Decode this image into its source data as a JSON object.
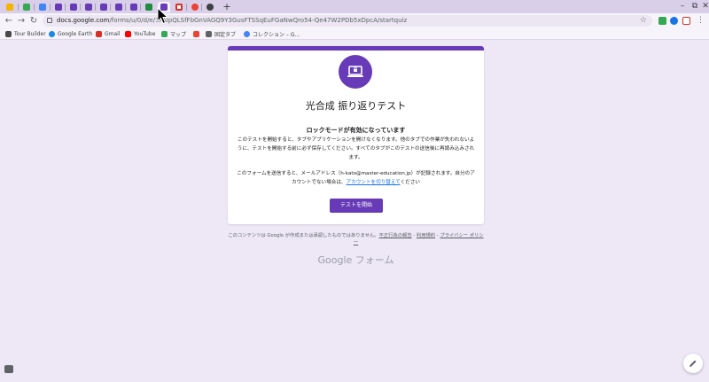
{
  "browser": {
    "url_host": "docs.google.com",
    "url_path": "/forms/u/0/d/e/1FAIpQLSfFbGnVAGQ9Y3GusFTSSqEuFGaNwQro54-Qe47W2PDb5xDpcA/startquiz",
    "new_tab_symbol": "+",
    "window_controls": [
      "–",
      "⧉",
      "✕"
    ]
  },
  "bookmarks": [
    {
      "label": "Tour Builder",
      "color": "#4a4a4a"
    },
    {
      "label": "Google Earth",
      "color": "#1e88e5"
    },
    {
      "label": "Gmail",
      "color": "#d93025"
    },
    {
      "label": "YouTube",
      "color": "#ff0000"
    },
    {
      "label": "マップ",
      "color": "#34a853"
    },
    {
      "label": "",
      "color": "#ea4335"
    },
    {
      "label": "固定タブ",
      "color": "#5f6368"
    },
    {
      "label": "コレクション – G...",
      "color": "#4285f4"
    }
  ],
  "form": {
    "title": "光合成 振り返りテスト",
    "lock_heading": "ロックモードが有効になっています",
    "para1": "このテストを開始すると、タブやアプリケーションを開けなくなります。他のタブでの作業が失われないように、テストを開始する前に必ず保存してください。すべてのタブがこのテストの送信後に再読み込みされます。",
    "para2_before": "このフォームを送信すると、メールアドレス（h-kato@master-education.jp）が記録されます。自分のアカウントでない場合は、",
    "para2_link": "アカウントを切り替えて",
    "para2_after": "ください",
    "start_button": "テストを開始"
  },
  "footer": {
    "disclaimer_text": "このコンテンツは Google が作成または承認したものではありません。",
    "report_link": "不正行為の報告",
    "sep1": " - ",
    "terms_link": "利用規約",
    "sep2": " - ",
    "privacy_link": "プライバシー ポリシー",
    "brand": "Google フォーム"
  },
  "colors": {
    "accent": "#673ab7",
    "background": "#ede7f6"
  }
}
